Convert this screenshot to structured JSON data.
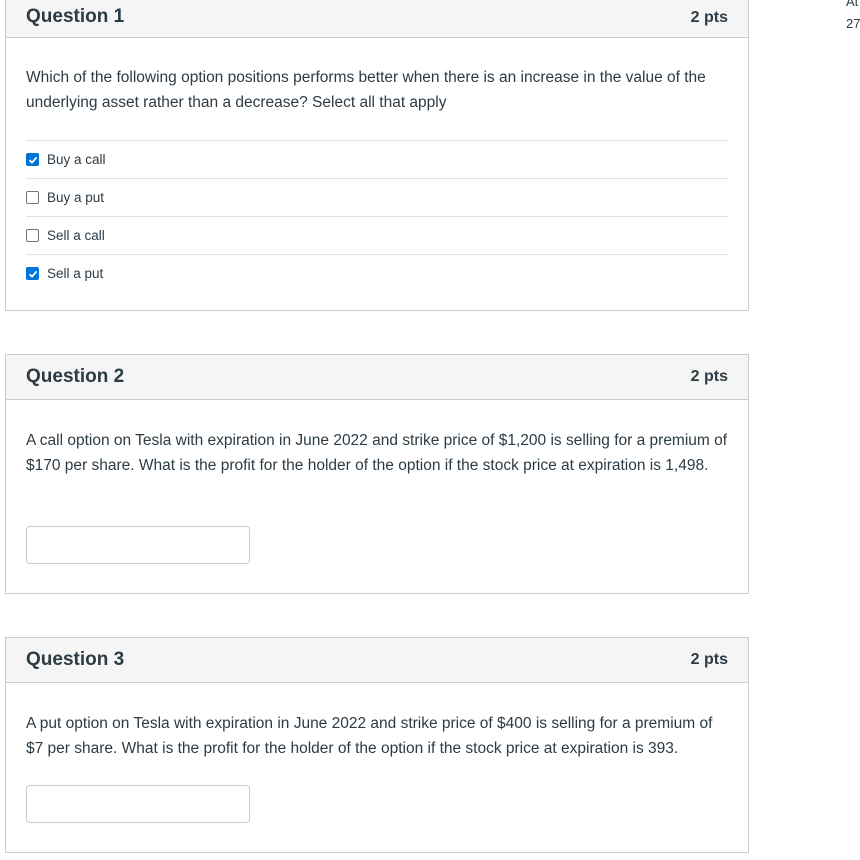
{
  "edge": {
    "top": "At",
    "number": "27"
  },
  "questions": [
    {
      "title": "Question 1",
      "points": "2 pts",
      "text": "Which of the following option positions performs better when there is an increase in the value of the underlying asset rather than a decrease? Select all that apply",
      "answers": [
        {
          "label": "Buy a call",
          "checked": true
        },
        {
          "label": "Buy a put",
          "checked": false
        },
        {
          "label": "Sell a call",
          "checked": false
        },
        {
          "label": "Sell a put",
          "checked": true
        }
      ]
    },
    {
      "title": "Question 2",
      "points": "2 pts",
      "text": "A call option on Tesla with expiration in June 2022 and strike price of $1,200 is selling for a premium of $170 per share. What is the profit for the holder of the option if the stock price at expiration is 1,498.",
      "input_value": ""
    },
    {
      "title": "Question 3",
      "points": "2 pts",
      "text": "A put option on Tesla with expiration in June 2022 and strike price of $400 is selling for a premium of $7 per share. What is the profit for the holder of the option if the stock price at expiration is 393.",
      "input_value": ""
    }
  ]
}
